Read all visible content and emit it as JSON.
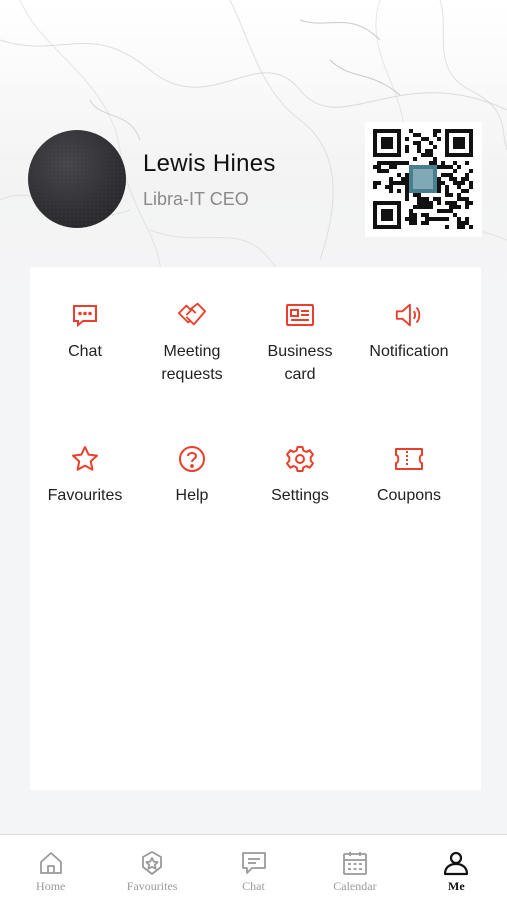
{
  "profile": {
    "name": "Lewis Hines",
    "title": "Libra-IT CEO"
  },
  "menu": [
    {
      "label": "Chat",
      "icon": "chat-icon"
    },
    {
      "label": "Meeting requests",
      "icon": "handshake-icon"
    },
    {
      "label": "Business card",
      "icon": "business-card-icon"
    },
    {
      "label": "Notification",
      "icon": "speaker-icon"
    },
    {
      "label": "Favourites",
      "icon": "star-icon"
    },
    {
      "label": "Help",
      "icon": "help-icon"
    },
    {
      "label": "Settings",
      "icon": "gear-icon"
    },
    {
      "label": "Coupons",
      "icon": "ticket-icon"
    }
  ],
  "tabbar": [
    {
      "label": "Home",
      "icon": "home-icon",
      "active": false
    },
    {
      "label": "Favourites",
      "icon": "badge-star-icon",
      "active": false
    },
    {
      "label": "Chat",
      "icon": "chat-bubble-icon",
      "active": false
    },
    {
      "label": "Calendar",
      "icon": "calendar-icon",
      "active": false
    },
    {
      "label": "Me",
      "icon": "person-icon",
      "active": true
    }
  ],
  "colors": {
    "accent": "#e8402c",
    "tab_inactive": "#9a9a9a",
    "tab_active": "#111111"
  }
}
